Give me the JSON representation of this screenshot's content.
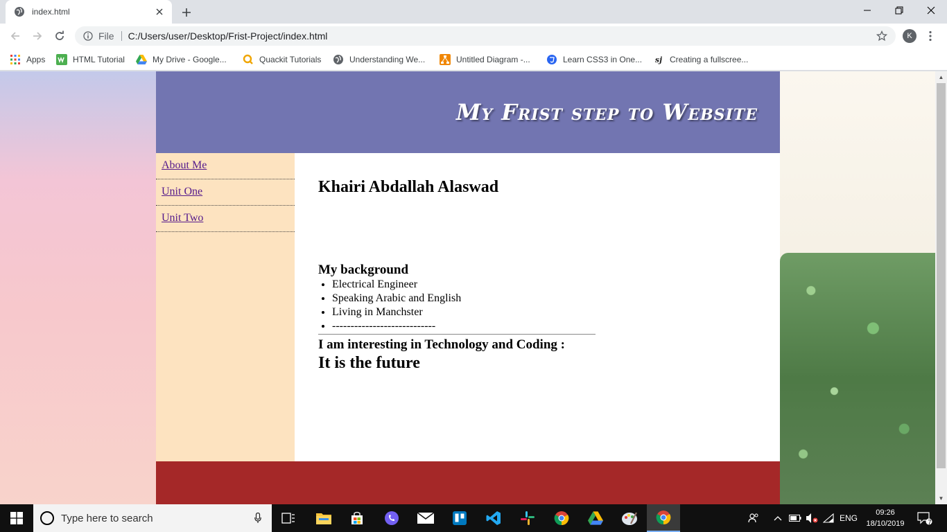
{
  "browser": {
    "tab_title": "index.html",
    "new_tab_symbol": "+",
    "file_label": "File",
    "url": "C:/Users/user/Desktop/Frist-Project/index.html",
    "profile_initial": "K"
  },
  "bookmarks": {
    "items": [
      {
        "label": "Apps",
        "icon": "apps-grid-icon"
      },
      {
        "label": "HTML Tutorial",
        "icon": "w3-icon"
      },
      {
        "label": "My Drive - Google...",
        "icon": "google-drive-icon"
      },
      {
        "label": "Quackit Tutorials",
        "icon": "quackit-icon"
      },
      {
        "label": "Understanding We...",
        "icon": "globe-icon"
      },
      {
        "label": "Untitled Diagram -...",
        "icon": "drawio-icon"
      },
      {
        "label": "Learn CSS3 in One...",
        "icon": "css-icon"
      },
      {
        "label": "Creating a fullscree...",
        "icon": "sj-icon"
      }
    ]
  },
  "page": {
    "site_title": "My Frist step to Website",
    "nav": [
      {
        "label": "About Me"
      },
      {
        "label": "Unit One"
      },
      {
        "label": "Unit Two"
      }
    ],
    "name": "Khairi Abdallah Alaswad",
    "background_heading": "My background",
    "background_items": [
      "Electrical Engineer",
      "Speaking Arabic and English",
      "Living in Manchster",
      "----------------------------"
    ],
    "interest": "I am interesting in Technology and Coding :",
    "future": "It is the future"
  },
  "colors": {
    "header": "#7275b1",
    "sidebar": "#fde3c0",
    "footer": "#a52828",
    "link": "#551a8b"
  },
  "taskbar": {
    "search_placeholder": "Type here to search",
    "language": "ENG",
    "time": "09:26",
    "date": "18/10/2019",
    "notification_count": "7"
  }
}
